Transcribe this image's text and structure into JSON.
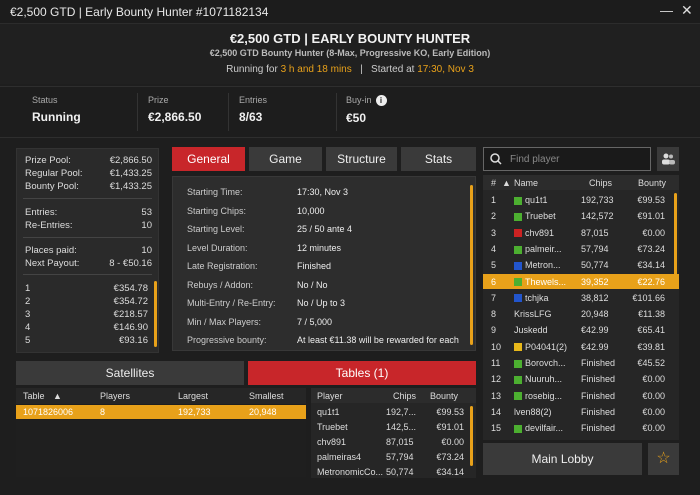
{
  "window": {
    "title": "€2,500 GTD | Early Bounty Hunter #1071182134",
    "minimize": "—",
    "close": "✕"
  },
  "header": {
    "title": "€2,500 GTD | EARLY BOUNTY HUNTER",
    "subtitle": "€2,500 GTD Bounty Hunter (8-Max, Progressive KO, Early Edition)",
    "running_label": "Running for",
    "running_value": "3 h and 18 mins",
    "sep": "|",
    "started_label": "Started at",
    "started_value": "17:30, Nov 3"
  },
  "stats": [
    {
      "label": "Status",
      "value": "Running"
    },
    {
      "label": "Prize",
      "value": "€2,866.50"
    },
    {
      "label": "Entries",
      "value": "8/63"
    },
    {
      "label": "Buy-in",
      "value": "€50"
    }
  ],
  "prize_info": [
    {
      "k": "Prize Pool:",
      "v": "€2,866.50"
    },
    {
      "k": "Regular Pool:",
      "v": "€1,433.25"
    },
    {
      "k": "Bounty Pool:",
      "v": "€1,433.25"
    },
    {
      "k": "Entries:",
      "v": "53"
    },
    {
      "k": "Re-Entries:",
      "v": "10"
    },
    {
      "k": "Places paid:",
      "v": "10"
    },
    {
      "k": "Next Payout:",
      "v": "8 - €50.16"
    }
  ],
  "payouts": [
    {
      "p": "1",
      "v": "€354.78"
    },
    {
      "p": "2",
      "v": "€354.72"
    },
    {
      "p": "3",
      "v": "€218.57"
    },
    {
      "p": "4",
      "v": "€146.90"
    },
    {
      "p": "5",
      "v": "€93.16"
    }
  ],
  "tabs": [
    "General",
    "Game",
    "Structure",
    "Stats"
  ],
  "general": [
    {
      "k": "Starting Time:",
      "v": "17:30, Nov 3"
    },
    {
      "k": "Starting Chips:",
      "v": "10,000"
    },
    {
      "k": "Starting Level:",
      "v": "25 / 50 ante 4"
    },
    {
      "k": "Level Duration:",
      "v": "12 minutes"
    },
    {
      "k": "Late Registration:",
      "v": "Finished"
    },
    {
      "k": "Rebuys / Addon:",
      "v": "No / No"
    },
    {
      "k": "Multi-Entry / Re-Entry:",
      "v": "No / Up to 3"
    },
    {
      "k": "Min / Max Players:",
      "v": "7 / 5,000"
    },
    {
      "k": "Progressive bounty:",
      "v": "At least €11.38 will be rewarded for each"
    }
  ],
  "lower_tabs": {
    "satellites": "Satellites",
    "tables": "Tables (1)"
  },
  "tables": {
    "headers": [
      "Table",
      "Players",
      "Largest",
      "Smallest"
    ],
    "rows": [
      {
        "table": "1071826006",
        "players": "8",
        "largest": "192,733",
        "smallest": "20,948"
      }
    ]
  },
  "table_players": {
    "headers": [
      "Player",
      "Chips",
      "Bounty"
    ],
    "rows": [
      {
        "n": "qu1t1",
        "c": "192,7...",
        "b": "€99.53"
      },
      {
        "n": "Truebet",
        "c": "142,5...",
        "b": "€91.01"
      },
      {
        "n": "chv891",
        "c": "87,015",
        "b": "€0.00"
      },
      {
        "n": "palmeiras4",
        "c": "57,794",
        "b": "€73.24"
      },
      {
        "n": "MetronomicCo...",
        "c": "50,774",
        "b": "€34.14"
      }
    ]
  },
  "search": {
    "placeholder": "Find player"
  },
  "players": {
    "headers": [
      "#",
      "Name",
      "Chips",
      "Bounty"
    ],
    "rows": [
      {
        "r": "1",
        "n": "qu1t1",
        "c": "192,733",
        "b": "€99.53",
        "col": "#4caf30"
      },
      {
        "r": "2",
        "n": "Truebet",
        "c": "142,572",
        "b": "€91.01",
        "col": "#4caf30"
      },
      {
        "r": "3",
        "n": "chv891",
        "c": "87,015",
        "b": "€0.00",
        "col": "#cc2222"
      },
      {
        "r": "4",
        "n": "palmeir...",
        "c": "57,794",
        "b": "€73.24",
        "col": "#4caf30"
      },
      {
        "r": "5",
        "n": "Metron...",
        "c": "50,774",
        "b": "€34.14",
        "col": "#2255cc"
      },
      {
        "r": "6",
        "n": "Thewels...",
        "c": "39,352",
        "b": "€22.76",
        "col": "#4caf30"
      },
      {
        "r": "7",
        "n": "tchjka",
        "c": "38,812",
        "b": "€101.66",
        "col": "#2255cc"
      },
      {
        "r": "8",
        "n": "KrissLFG",
        "c": "20,948",
        "b": "€11.38",
        "col": ""
      },
      {
        "r": "9",
        "n": "Juskedd",
        "c": "€42.99",
        "b": "€65.41",
        "col": ""
      },
      {
        "r": "10",
        "n": "P04041(2)",
        "c": "€42.99",
        "b": "€39.81",
        "col": "#e8b81a"
      },
      {
        "r": "11",
        "n": "Borovch...",
        "c": "Finished",
        "b": "€45.52",
        "col": "#4caf30"
      },
      {
        "r": "12",
        "n": "Nuuruh...",
        "c": "Finished",
        "b": "€0.00",
        "col": "#4caf30"
      },
      {
        "r": "13",
        "n": "rosebig...",
        "c": "Finished",
        "b": "€0.00",
        "col": "#4caf30"
      },
      {
        "r": "14",
        "n": "lven88(2)",
        "c": "Finished",
        "b": "€0.00",
        "col": ""
      },
      {
        "r": "15",
        "n": "devilfair...",
        "c": "Finished",
        "b": "€0.00",
        "col": "#4caf30"
      }
    ]
  },
  "main_lobby": "Main Lobby"
}
